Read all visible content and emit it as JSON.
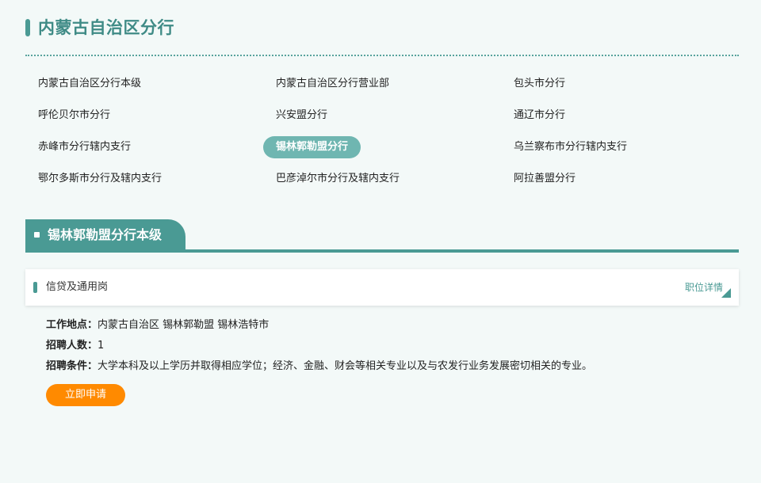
{
  "page": {
    "title": "内蒙古自治区分行"
  },
  "branches": [
    [
      "内蒙古自治区分行本级",
      "内蒙古自治区分行营业部",
      "包头市分行"
    ],
    [
      "呼伦贝尔市分行",
      "兴安盟分行",
      "通辽市分行"
    ],
    [
      "赤峰市分行辖内支行",
      "锡林郭勒盟分行",
      "乌兰察布市分行辖内支行"
    ],
    [
      "鄂尔多斯市分行及辖内支行",
      "巴彦淖尔市分行及辖内支行",
      "阿拉善盟分行"
    ]
  ],
  "active_branch": "锡林郭勒盟分行",
  "section": {
    "title": "锡林郭勒盟分行本级"
  },
  "job": {
    "title": "信贷及通用岗",
    "detail_link": "职位详情",
    "location_label": "工作地点：",
    "location": "内蒙古自治区 锡林郭勒盟 锡林浩特市",
    "headcount_label": "招聘人数：",
    "headcount": "1",
    "requirements_label": "招聘条件：",
    "requirements": "大学本科及以上学历并取得相应学位；经济、金融、财会等相关专业以及与农发行业务发展密切相关的专业。",
    "apply_label": "立即申请"
  },
  "colors": {
    "accent": "#4a9a94",
    "active_pill": "#6fb6b1",
    "apply_button": "#ff8a00",
    "background": "#f3f9f8"
  }
}
